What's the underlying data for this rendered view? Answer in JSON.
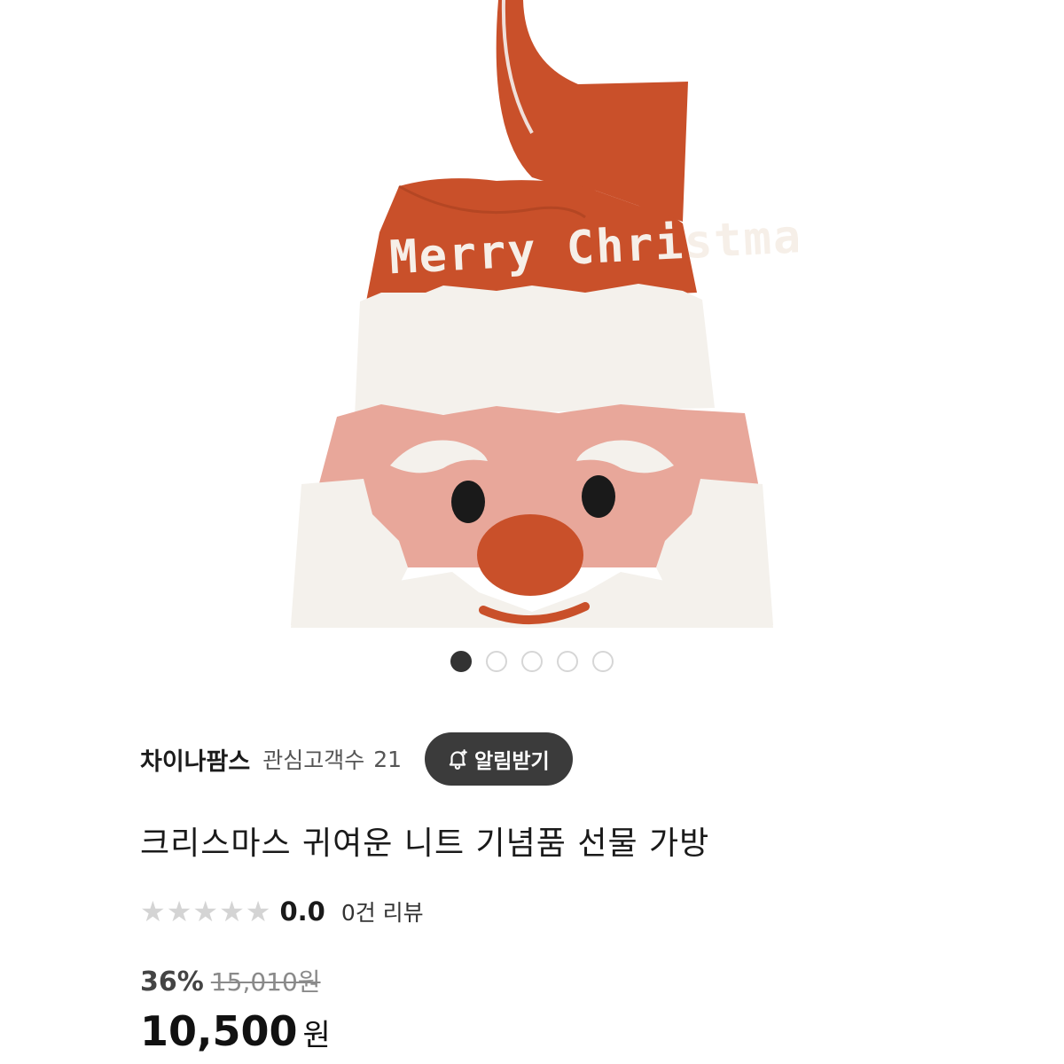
{
  "product": {
    "image_alt": "Santa knit bag with Merry Christmas lettering",
    "image_text": "Merry Christmas",
    "colors": {
      "knit_orange": "#c9502a",
      "knit_white": "#f4f1ec",
      "knit_pink": "#e8a79a",
      "knit_black": "#1a1a1a"
    }
  },
  "carousel": {
    "total": 5,
    "active": 1
  },
  "seller": {
    "name": "차이나팜스",
    "follower_label": "관심고객수",
    "follower_count": "21",
    "notify_label": "알림받기",
    "notify_icon": "bell-plus-icon"
  },
  "title": "크리스마스 귀여운 니트 기념품 선물 가방",
  "rating": {
    "stars_filled": 0,
    "stars_total": 5,
    "star_glyph": "★",
    "score": "0.0",
    "review_label": "0건 리뷰"
  },
  "price": {
    "discount_rate": "36%",
    "original": "15,010원",
    "sale": "10,500",
    "unit": "원"
  },
  "theme": {
    "dot_active": "#333333",
    "button_bg": "#3b3b3b",
    "star_empty": "#d4d4d4"
  }
}
